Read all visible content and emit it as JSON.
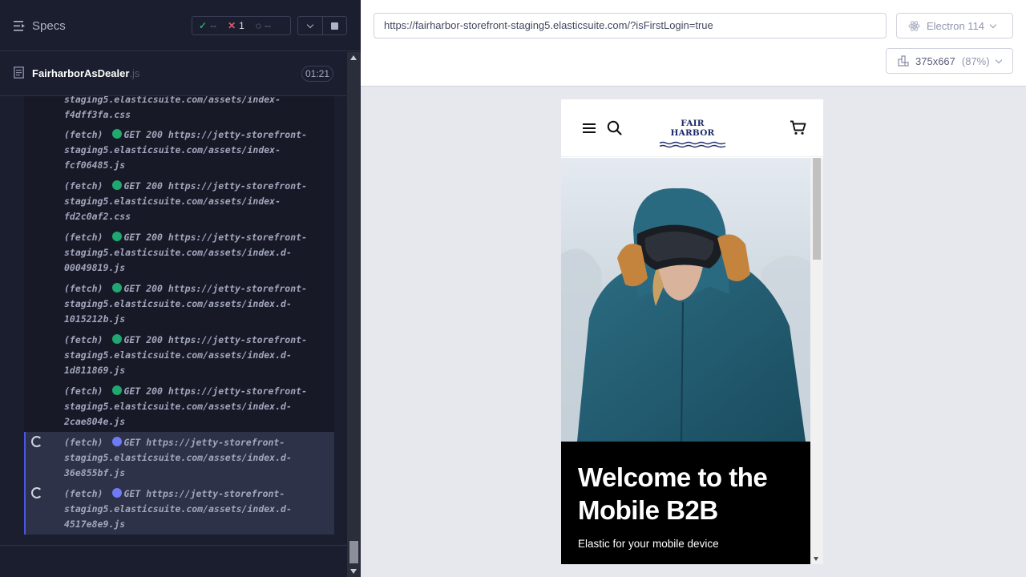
{
  "runner": {
    "specs_label": "Specs",
    "stats": {
      "passed": "--",
      "failed": "1",
      "pending": "--"
    },
    "spec": {
      "name": "FairharborAsDealer",
      "ext": ".js",
      "duration": "01:21"
    },
    "commands": [
      {
        "prefix": "",
        "method": "",
        "status": "",
        "lines": [
          "staging5.elasticsuite.com/assets/index-",
          "f4dff3fa.css"
        ],
        "state": "partial"
      },
      {
        "prefix": "(fetch)",
        "method": "GET",
        "status": "200",
        "lines": [
          "https://jetty-storefront-",
          "staging5.elasticsuite.com/assets/index-",
          "fcf06485.js"
        ],
        "state": "done"
      },
      {
        "prefix": "(fetch)",
        "method": "GET",
        "status": "200",
        "lines": [
          "https://jetty-storefront-",
          "staging5.elasticsuite.com/assets/index-",
          "fd2c0af2.css"
        ],
        "state": "done"
      },
      {
        "prefix": "(fetch)",
        "method": "GET",
        "status": "200",
        "lines": [
          "https://jetty-storefront-",
          "staging5.elasticsuite.com/assets/index.d-",
          "00049819.js"
        ],
        "state": "done"
      },
      {
        "prefix": "(fetch)",
        "method": "GET",
        "status": "200",
        "lines": [
          "https://jetty-storefront-",
          "staging5.elasticsuite.com/assets/index.d-",
          "1015212b.js"
        ],
        "state": "done"
      },
      {
        "prefix": "(fetch)",
        "method": "GET",
        "status": "200",
        "lines": [
          "https://jetty-storefront-",
          "staging5.elasticsuite.com/assets/index.d-",
          "1d811869.js"
        ],
        "state": "done"
      },
      {
        "prefix": "(fetch)",
        "method": "GET",
        "status": "200",
        "lines": [
          "https://jetty-storefront-",
          "staging5.elasticsuite.com/assets/index.d-",
          "2cae804e.js"
        ],
        "state": "done"
      },
      {
        "prefix": "(fetch)",
        "method": "GET",
        "status": "",
        "lines": [
          "https://jetty-storefront-",
          "staging5.elasticsuite.com/assets/index.d-",
          "36e855bf.js"
        ],
        "state": "pending"
      },
      {
        "prefix": "(fetch)",
        "method": "GET",
        "status": "",
        "lines": [
          "https://jetty-storefront-",
          "staging5.elasticsuite.com/assets/index.d-",
          "4517e8e9.js"
        ],
        "state": "pending"
      }
    ]
  },
  "aut": {
    "url": "https://fairharbor-storefront-staging5.elasticsuite.com/?isFirstLogin=true",
    "browser": "Electron 114",
    "viewport_size": "375x667",
    "viewport_zoom": "(87%)"
  },
  "site": {
    "logo": "FAIR HARBOR",
    "hero_title": "Welcome to the Mobile B2B",
    "hero_subtitle": "Elastic for your mobile device"
  },
  "colors": {
    "pass": "#1fa971",
    "fail": "#e45770",
    "pending_dot": "#6f7bf6",
    "brand_navy": "#1f2b6b"
  }
}
